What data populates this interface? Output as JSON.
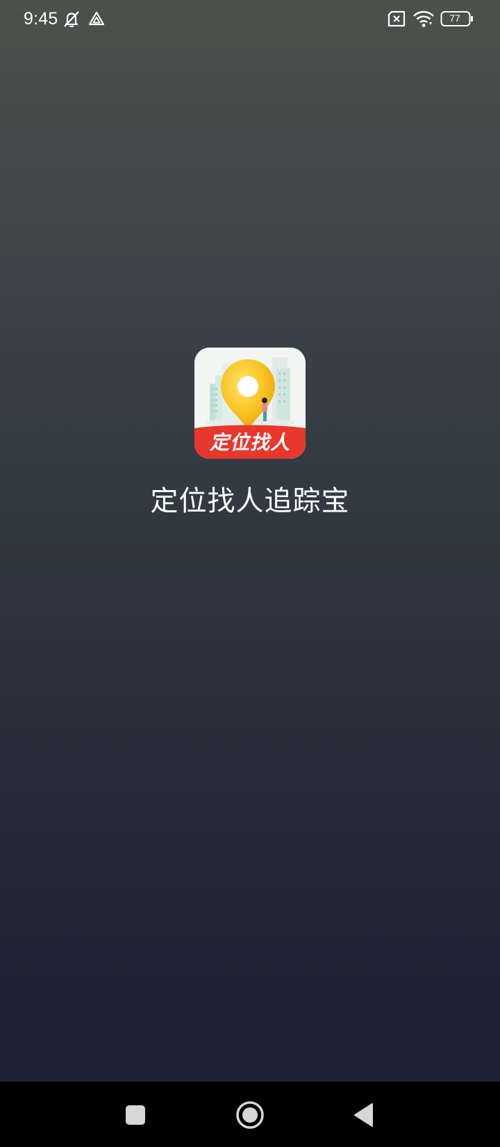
{
  "status_bar": {
    "time": "9:45",
    "battery_level": "77",
    "icons": [
      "bell-muted-icon",
      "drive-triangle-icon",
      "sim-missing-icon",
      "wifi-icon",
      "battery-icon"
    ]
  },
  "splash": {
    "app_icon_label": "定位找人",
    "app_name": "定位找人追踪宝"
  },
  "colors": {
    "icon_banner": "#e8372c",
    "pin_yellow": "#f9c21f",
    "nav_bar": "#000000"
  },
  "nav_bar": {
    "buttons": [
      "recents-button",
      "home-button",
      "back-button"
    ]
  }
}
